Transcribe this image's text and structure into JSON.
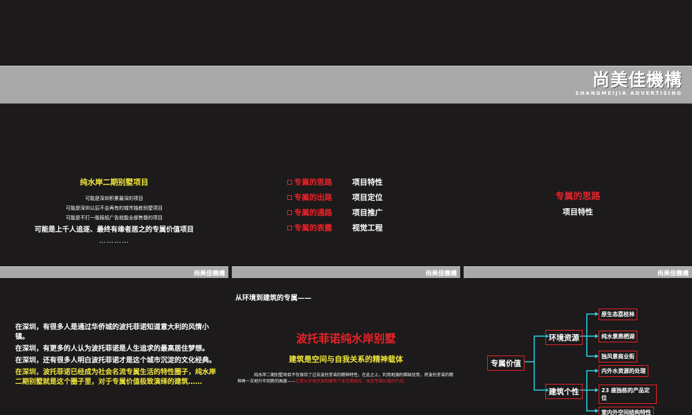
{
  "brand": {
    "name": "尚美佳機構",
    "sub": "SHANGMEIJIA ADVERTISING",
    "footer": "尚美佳機構"
  },
  "slide1": {
    "title": "纯水岸二期别墅项目",
    "lines": [
      "可能是深圳积累最深的项目",
      "可能是深圳以后不会再有的城市独栋别墅项目",
      "可能是不打一版报纸广告就能全部售罄的项目"
    ],
    "big_line": "可能是上千人追逐、最终有缘者居之的专属价值项目",
    "dots": "…………"
  },
  "slide2": {
    "items": [
      {
        "left": "专属的思路",
        "right": "项目特性"
      },
      {
        "left": "专属的出路",
        "right": "项目定位"
      },
      {
        "left": "专属的通路",
        "right": "项目推广"
      },
      {
        "left": "专属的表露",
        "right": "视觉工程"
      }
    ]
  },
  "slide3": {
    "title": "专属的思路",
    "subtitle": "项目特性"
  },
  "slide4": {
    "p1": "在深圳，有很多人是通过华侨城的波托菲诺知道意大利的风情小镇。",
    "p2": "在深圳，有更多的人认为波托菲诺是人生追求的最高居住梦想。",
    "p3": "在深圳，还有很多人明白波托菲诺才是这个城市沉淀的文化经典。",
    "p4": "在深圳，波托菲诺已经成为社会名流专属生活的特性圈子，纯水岸二期别墅就是这个圈子里，对于专属价值极致演绎的建筑……"
  },
  "slide5": {
    "pre": "从环境到建筑的专属——",
    "title": "波托菲诺纯水岸别墅",
    "subtitle": "建筑是空间与自我关系的精神载体",
    "body": "纯水岸二期别墅项目不仅保持了过去波托菲诺的精神特性，在此之上，利用地源的稀缺优势，将波托菲诺的精神再一次地升华到新的高度——",
    "body_red": "它是从环境资源到建筑个体完美结合，体现专属价值的产品。"
  },
  "slide6": {
    "root": "专属价值",
    "branch1": "环境资源",
    "branch2": "建筑个性",
    "leaves1": [
      "原生态荔枝林",
      "纯水景燕栖湖",
      "独风景商业街"
    ],
    "leaves2": [
      "内外水资源的处理",
      "23 座独栋的产品定位",
      "室内外空间结构特性"
    ],
    "colors": {
      "line": "#2ad4e6",
      "border": "#e8232a"
    }
  }
}
